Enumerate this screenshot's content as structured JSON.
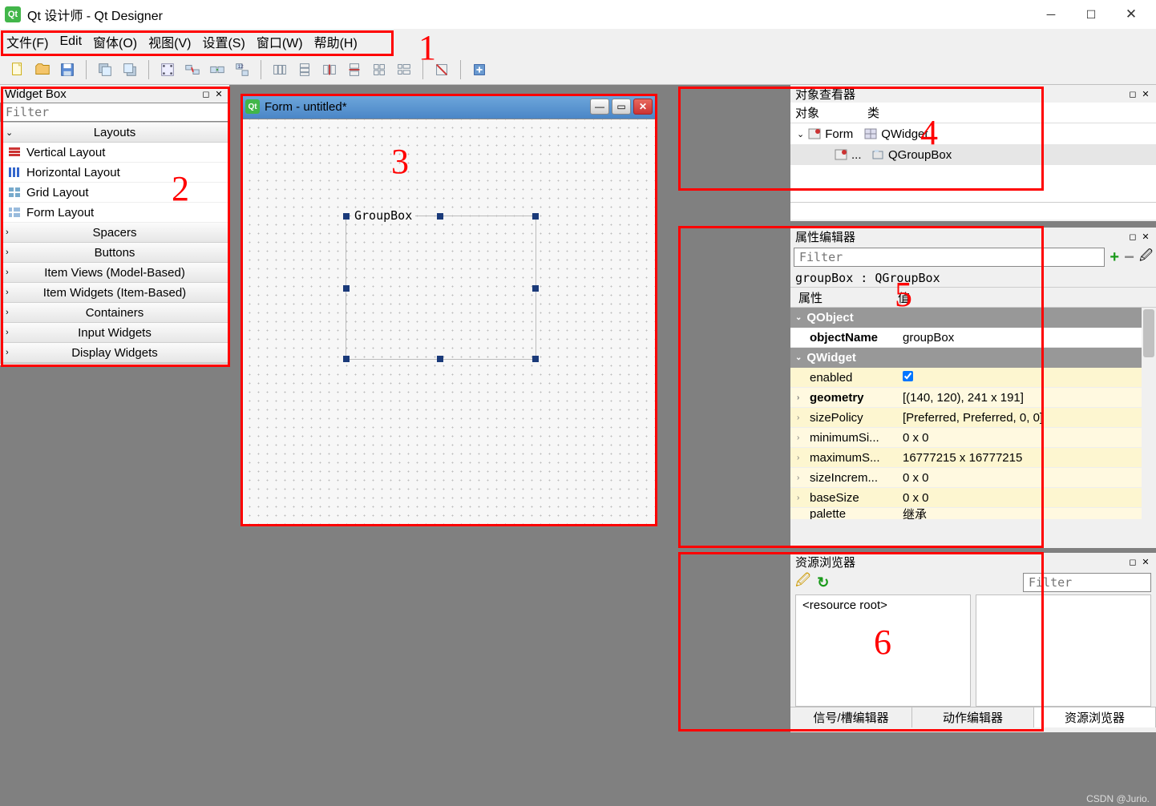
{
  "title": "Qt 设计师 - Qt Designer",
  "menus": [
    "文件(F)",
    "Edit",
    "窗体(O)",
    "视图(V)",
    "设置(S)",
    "窗口(W)",
    "帮助(H)"
  ],
  "widgetbox": {
    "title": "Widget Box",
    "filter_ph": "Filter",
    "categories": {
      "layouts": "Layouts",
      "spacers": "Spacers",
      "buttons": "Buttons",
      "itemviews": "Item Views (Model-Based)",
      "itemwidgets": "Item Widgets (Item-Based)",
      "containers": "Containers",
      "inputwidgets": "Input Widgets",
      "displaywidgets": "Display Widgets"
    },
    "layout_items": [
      "Vertical Layout",
      "Horizontal Layout",
      "Grid Layout",
      "Form Layout"
    ]
  },
  "form": {
    "title": "Form - untitled*",
    "groupbox_label": "GroupBox"
  },
  "objinsp": {
    "title": "对象查看器",
    "cols": [
      "对象",
      "类"
    ],
    "row1_obj": "Form",
    "row1_cls": "QWidget",
    "row2_obj": "...",
    "row2_cls": "QGroupBox"
  },
  "propedit": {
    "title": "属性编辑器",
    "filter_ph": "Filter",
    "objpath": "groupBox : QGroupBox",
    "cols": [
      "属性",
      "值"
    ],
    "group1": "QObject",
    "group2": "QWidget",
    "rows": [
      {
        "name": "objectName",
        "value": "groupBox"
      },
      {
        "name": "enabled",
        "value": "check"
      },
      {
        "name": "geometry",
        "value": "[(140, 120), 241 x 191]"
      },
      {
        "name": "sizePolicy",
        "value": "[Preferred, Preferred, 0, 0]"
      },
      {
        "name": "minimumSi...",
        "value": "0 x 0"
      },
      {
        "name": "maximumS...",
        "value": "16777215 x 16777215"
      },
      {
        "name": "sizeIncrem...",
        "value": "0 x 0"
      },
      {
        "name": "baseSize",
        "value": "0 x 0"
      },
      {
        "name": "palette",
        "value": "继承"
      }
    ]
  },
  "resbrowse": {
    "title": "资源浏览器",
    "filter_ph": "Filter",
    "root": "<resource root>",
    "tabs": [
      "信号/槽编辑器",
      "动作编辑器",
      "资源浏览器"
    ]
  },
  "watermark": "CSDN @Jurio."
}
